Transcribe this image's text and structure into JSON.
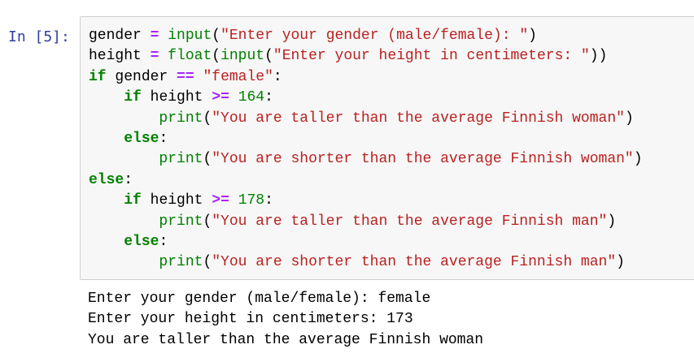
{
  "cell": {
    "prompt": "In [5]:",
    "code_lines": [
      [
        {
          "t": "name",
          "v": "gender"
        },
        {
          "t": "text",
          "v": " "
        },
        {
          "t": "op",
          "v": "="
        },
        {
          "t": "text",
          "v": " "
        },
        {
          "t": "builtin",
          "v": "input"
        },
        {
          "t": "punct",
          "v": "("
        },
        {
          "t": "string",
          "v": "\"Enter your gender (male/female): \""
        },
        {
          "t": "punct",
          "v": ")"
        }
      ],
      [
        {
          "t": "name",
          "v": "height"
        },
        {
          "t": "text",
          "v": " "
        },
        {
          "t": "op",
          "v": "="
        },
        {
          "t": "text",
          "v": " "
        },
        {
          "t": "builtin",
          "v": "float"
        },
        {
          "t": "punct",
          "v": "("
        },
        {
          "t": "builtin",
          "v": "input"
        },
        {
          "t": "punct",
          "v": "("
        },
        {
          "t": "string",
          "v": "\"Enter your height in centimeters: \""
        },
        {
          "t": "punct",
          "v": "))"
        }
      ],
      [
        {
          "t": "keyword",
          "v": "if"
        },
        {
          "t": "text",
          "v": " "
        },
        {
          "t": "name",
          "v": "gender"
        },
        {
          "t": "text",
          "v": " "
        },
        {
          "t": "op",
          "v": "=="
        },
        {
          "t": "text",
          "v": " "
        },
        {
          "t": "string",
          "v": "\"female\""
        },
        {
          "t": "punct",
          "v": ":"
        }
      ],
      [
        {
          "t": "text",
          "v": "    "
        },
        {
          "t": "keyword",
          "v": "if"
        },
        {
          "t": "text",
          "v": " "
        },
        {
          "t": "name",
          "v": "height"
        },
        {
          "t": "text",
          "v": " "
        },
        {
          "t": "op",
          "v": ">="
        },
        {
          "t": "text",
          "v": " "
        },
        {
          "t": "number",
          "v": "164"
        },
        {
          "t": "punct",
          "v": ":"
        }
      ],
      [
        {
          "t": "text",
          "v": "        "
        },
        {
          "t": "builtin",
          "v": "print"
        },
        {
          "t": "punct",
          "v": "("
        },
        {
          "t": "string",
          "v": "\"You are taller than the average Finnish woman\""
        },
        {
          "t": "punct",
          "v": ")"
        }
      ],
      [
        {
          "t": "text",
          "v": "    "
        },
        {
          "t": "keyword",
          "v": "else"
        },
        {
          "t": "punct",
          "v": ":"
        }
      ],
      [
        {
          "t": "text",
          "v": "        "
        },
        {
          "t": "builtin",
          "v": "print"
        },
        {
          "t": "punct",
          "v": "("
        },
        {
          "t": "string",
          "v": "\"You are shorter than the average Finnish woman\""
        },
        {
          "t": "punct",
          "v": ")"
        }
      ],
      [
        {
          "t": "keyword",
          "v": "else"
        },
        {
          "t": "punct",
          "v": ":"
        }
      ],
      [
        {
          "t": "text",
          "v": "    "
        },
        {
          "t": "keyword",
          "v": "if"
        },
        {
          "t": "text",
          "v": " "
        },
        {
          "t": "name",
          "v": "height"
        },
        {
          "t": "text",
          "v": " "
        },
        {
          "t": "op",
          "v": ">="
        },
        {
          "t": "text",
          "v": " "
        },
        {
          "t": "number",
          "v": "178"
        },
        {
          "t": "punct",
          "v": ":"
        }
      ],
      [
        {
          "t": "text",
          "v": "        "
        },
        {
          "t": "builtin",
          "v": "print"
        },
        {
          "t": "punct",
          "v": "("
        },
        {
          "t": "string",
          "v": "\"You are taller than the average Finnish man\""
        },
        {
          "t": "punct",
          "v": ")"
        }
      ],
      [
        {
          "t": "text",
          "v": "    "
        },
        {
          "t": "keyword",
          "v": "else"
        },
        {
          "t": "punct",
          "v": ":"
        }
      ],
      [
        {
          "t": "text",
          "v": "        "
        },
        {
          "t": "builtin",
          "v": "print"
        },
        {
          "t": "punct",
          "v": "("
        },
        {
          "t": "string",
          "v": "\"You are shorter than the average Finnish man\""
        },
        {
          "t": "punct",
          "v": ")"
        }
      ]
    ],
    "output_lines": [
      "Enter your gender (male/female): female",
      "Enter your height in centimeters: 173",
      "You are taller than the average Finnish woman"
    ]
  },
  "colors": {
    "prompt": "#303f9f",
    "keyword": "#008000",
    "builtin": "#008000",
    "number": "#008000",
    "string": "#ba2121",
    "operator": "#aa22ff",
    "cell_background": "#f7f7f7",
    "cell_border": "#cfcfcf"
  }
}
